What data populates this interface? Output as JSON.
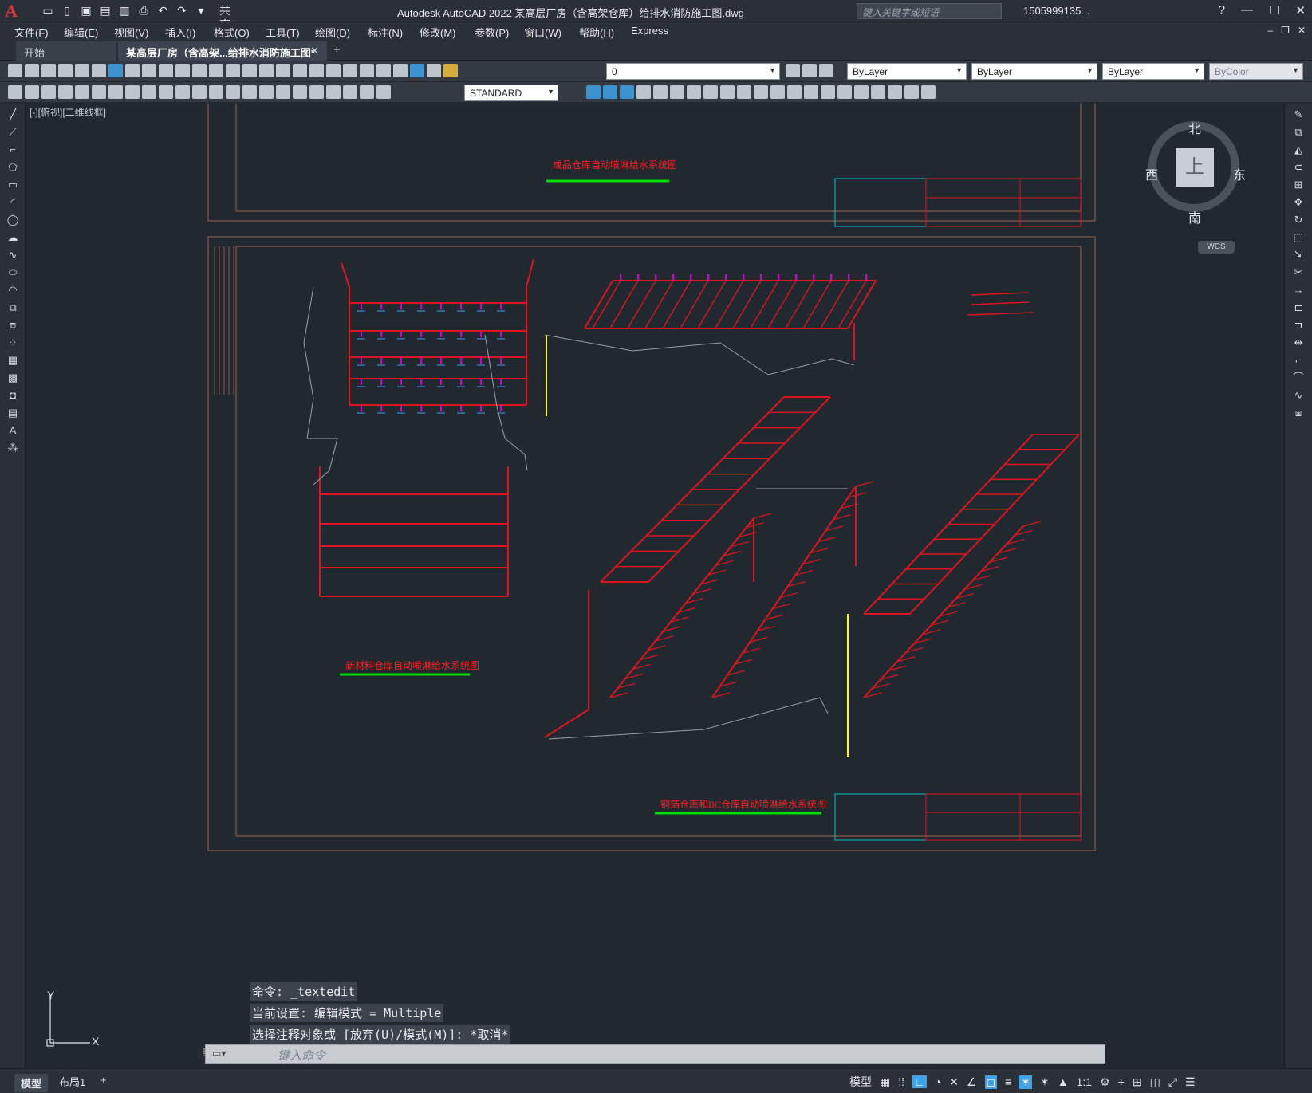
{
  "title_bar": {
    "app_title": "Autodesk AutoCAD 2022    某高层厂房（含高架仓库）给排水消防施工图.dwg",
    "share_label": "共享",
    "search_placeholder": "键入关键字或短语",
    "user": "1505999135..."
  },
  "menu": [
    "文件(F)",
    "编辑(E)",
    "视图(V)",
    "插入(I)",
    "格式(O)",
    "工具(T)",
    "绘图(D)",
    "标注(N)",
    "修改(M)",
    "参数(P)",
    "窗口(W)",
    "帮助(H)",
    "Express"
  ],
  "tabs": {
    "start": "开始",
    "active": "某高层厂房（含高架...给排水消防施工图*"
  },
  "toolbar": {
    "layer": "0",
    "color": "ByLayer",
    "linetype": "ByLayer",
    "lineweight": "ByLayer",
    "plotstyle": "ByColor",
    "textstyle": "STANDARD"
  },
  "viewport": {
    "label": "[-][俯视][二维线框]"
  },
  "viewcube": {
    "north": "北",
    "south": "南",
    "east": "东",
    "west": "西",
    "face": "上",
    "wcs": "WCS"
  },
  "ucs": {
    "x": "X",
    "y": "Y"
  },
  "drawing": {
    "title_top": "成品仓库自动喷淋给水系统图",
    "title_left": "新材料仓库自动喷淋给水系统图",
    "title_bottom": "铜箔仓库和BC仓库自动喷淋给水系统图"
  },
  "command": {
    "history": [
      "命令: _textedit",
      "当前设置: 编辑模式 = Multiple",
      "选择注释对象或 [放弃(U)/模式(M)]: *取消*"
    ],
    "placeholder": "键入命令"
  },
  "status": {
    "model": "模型",
    "layout": "布局1",
    "model_btn": "模型",
    "scale": "1:1"
  },
  "colors": {
    "accent": "#3ea3e8",
    "pipe": "#e0141c",
    "annot": "#d000d0",
    "dim": "#00e000",
    "frame": "#8a5a48"
  }
}
